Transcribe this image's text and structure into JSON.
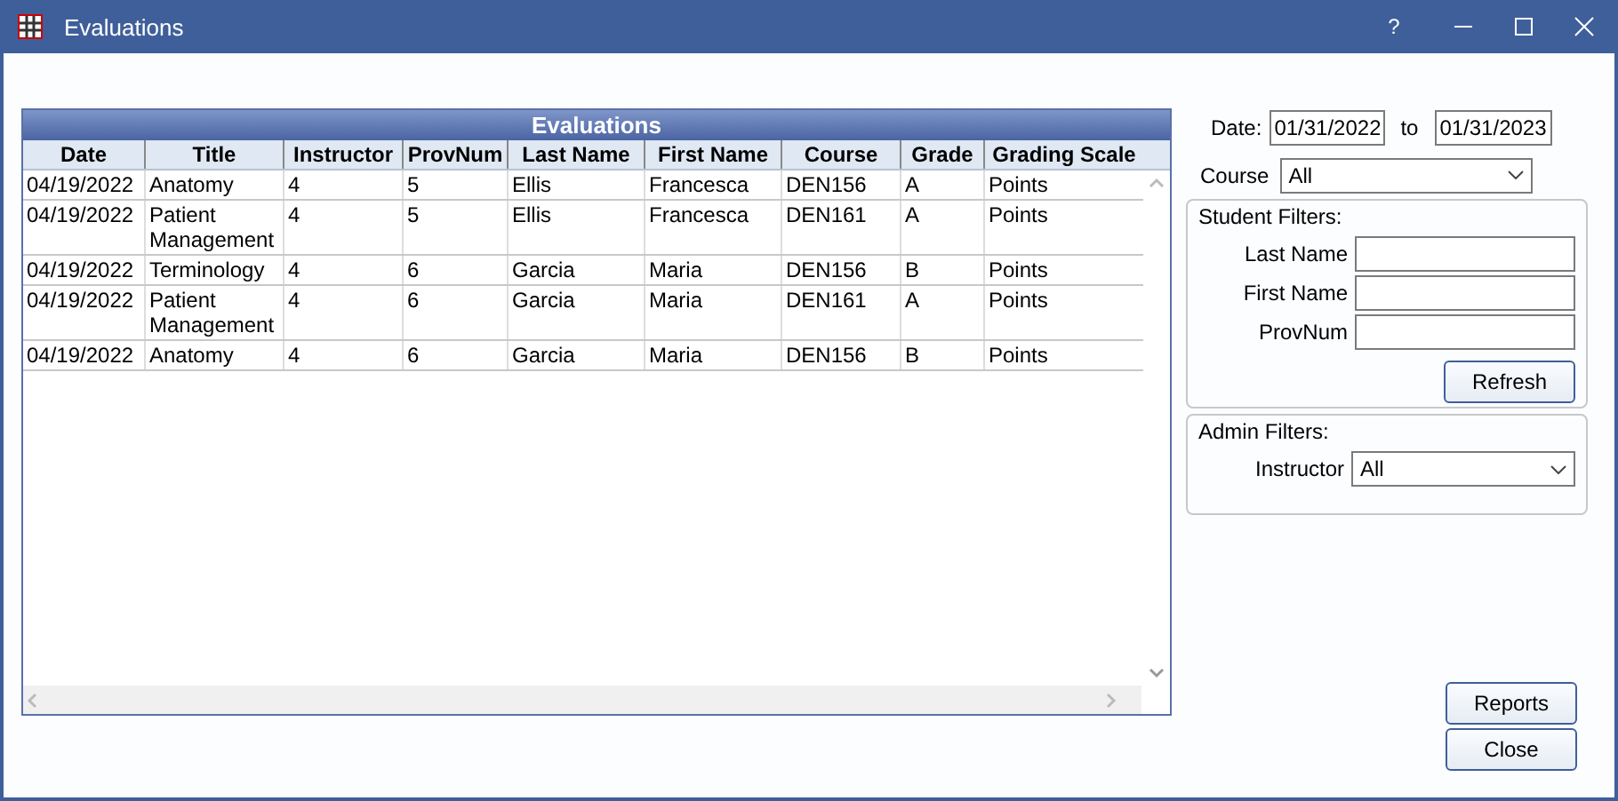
{
  "window": {
    "title": "Evaluations",
    "help": "?"
  },
  "grid": {
    "title": "Evaluations",
    "columns": [
      "Date",
      "Title",
      "Instructor",
      "ProvNum",
      "Last Name",
      "First Name",
      "Course",
      "Grade",
      "Grading Scale"
    ],
    "rows": [
      {
        "cells": [
          "04/19/2022",
          "Anatomy",
          "4",
          "5",
          "Ellis",
          "Francesca",
          "DEN156",
          "A",
          "Points"
        ]
      },
      {
        "cells": [
          "04/19/2022",
          "Patient Management",
          "4",
          "5",
          "Ellis",
          "Francesca",
          "DEN161",
          "A",
          "Points"
        ]
      },
      {
        "cells": [
          "04/19/2022",
          "Terminology",
          "4",
          "6",
          "Garcia",
          "Maria",
          "DEN156",
          "B",
          "Points"
        ]
      },
      {
        "cells": [
          "04/19/2022",
          "Patient Management",
          "4",
          "6",
          "Garcia",
          "Maria",
          "DEN161",
          "A",
          "Points"
        ]
      },
      {
        "cells": [
          "04/19/2022",
          "Anatomy",
          "4",
          "6",
          "Garcia",
          "Maria",
          "DEN156",
          "B",
          "Points"
        ]
      }
    ]
  },
  "date": {
    "label": "Date:",
    "from": "01/31/2022",
    "to_label": "to",
    "to": "01/31/2023"
  },
  "course": {
    "label": "Course",
    "value": "All"
  },
  "student_filters": {
    "title": "Student Filters:",
    "fields": [
      {
        "label": "Last Name"
      },
      {
        "label": "First Name"
      },
      {
        "label": "ProvNum"
      }
    ],
    "button": "Refresh"
  },
  "admin_filters": {
    "title": "Admin Filters:",
    "label": "Instructor",
    "value": "All"
  },
  "buttons": [
    "Reports",
    "Close"
  ]
}
